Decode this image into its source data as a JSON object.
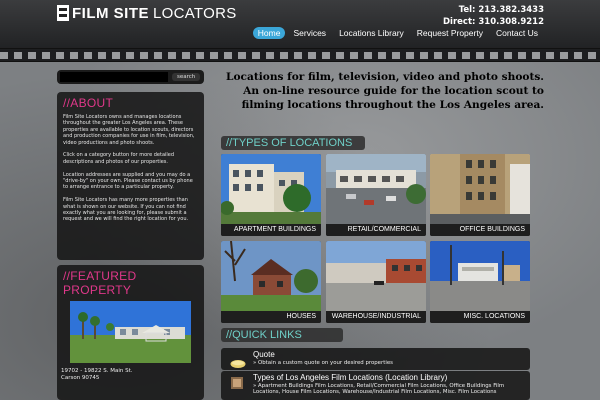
{
  "brand": {
    "logo_film": "FILM SITE",
    "logo_locators": "LOCATORS"
  },
  "contact": {
    "tel": "Tel: 213.382.3433",
    "direct": "Direct: 310.308.9212"
  },
  "nav": {
    "items": [
      {
        "label": "Home",
        "active": true
      },
      {
        "label": "Services"
      },
      {
        "label": "Locations Library"
      },
      {
        "label": "Request Property"
      },
      {
        "label": "Contact Us"
      }
    ]
  },
  "search": {
    "button_label": "search",
    "placeholder": ""
  },
  "about": {
    "title": "//ABOUT",
    "paragraphs": [
      "Film Site Locators owns and manages locations throughout the greater Los Angeles area. These properties are available to location scouts, directors and production companies for use in film, television, video productions and photo shoots.",
      "Click on a category button for more detailed descriptions and photos of our properties.",
      "Location addresses are supplied and you may do a \"drive-by\" on your own. Please contact us by phone to arrange entrance to a particular property.",
      "Film Site Locators has many more properties than what is shown on our website. If you can not find exactly what you are looking for, please submit a request and we will find the right location for you."
    ]
  },
  "featured": {
    "title": "//FEATURED PROPERTY",
    "address_line1": "19702 - 19822 S. Main St.",
    "address_line2": "Carson 90745"
  },
  "headline": {
    "line1": "Locations for film, television, video and photo shoots.",
    "line2": "An on-line resource guide for the location scout to filming locations throughout the Los Angeles area."
  },
  "types": {
    "title": "//TYPES OF LOCATIONS",
    "tiles": [
      {
        "caption": "APARTMENT BUILDINGS"
      },
      {
        "caption": "RETAIL/COMMERCIAL"
      },
      {
        "caption": "OFFICE BUILDINGS"
      },
      {
        "caption": "HOUSES"
      },
      {
        "caption": "WAREHOUSE/INDUSTRIAL"
      },
      {
        "caption": "MISC. LOCATIONS"
      }
    ]
  },
  "quick_links": {
    "title": "//QUICK LINKS",
    "items": [
      {
        "title": "Quote",
        "sub": "» Obtain a custom quote on your desired properties"
      },
      {
        "title": "Types of Los Angeles Film Locations (Location Library)",
        "sub": "» Apartment Buildings Film Locations, Retail/Commercial Film Locations, Office Buildings Film Locations, House Film Locations, Warehouse/Industrial Film Locations, Misc. Film Locations"
      }
    ]
  },
  "colors": {
    "accent_pink": "#e0388a",
    "accent_teal": "#6fd0c8",
    "nav_active": "#3ba6d8"
  }
}
